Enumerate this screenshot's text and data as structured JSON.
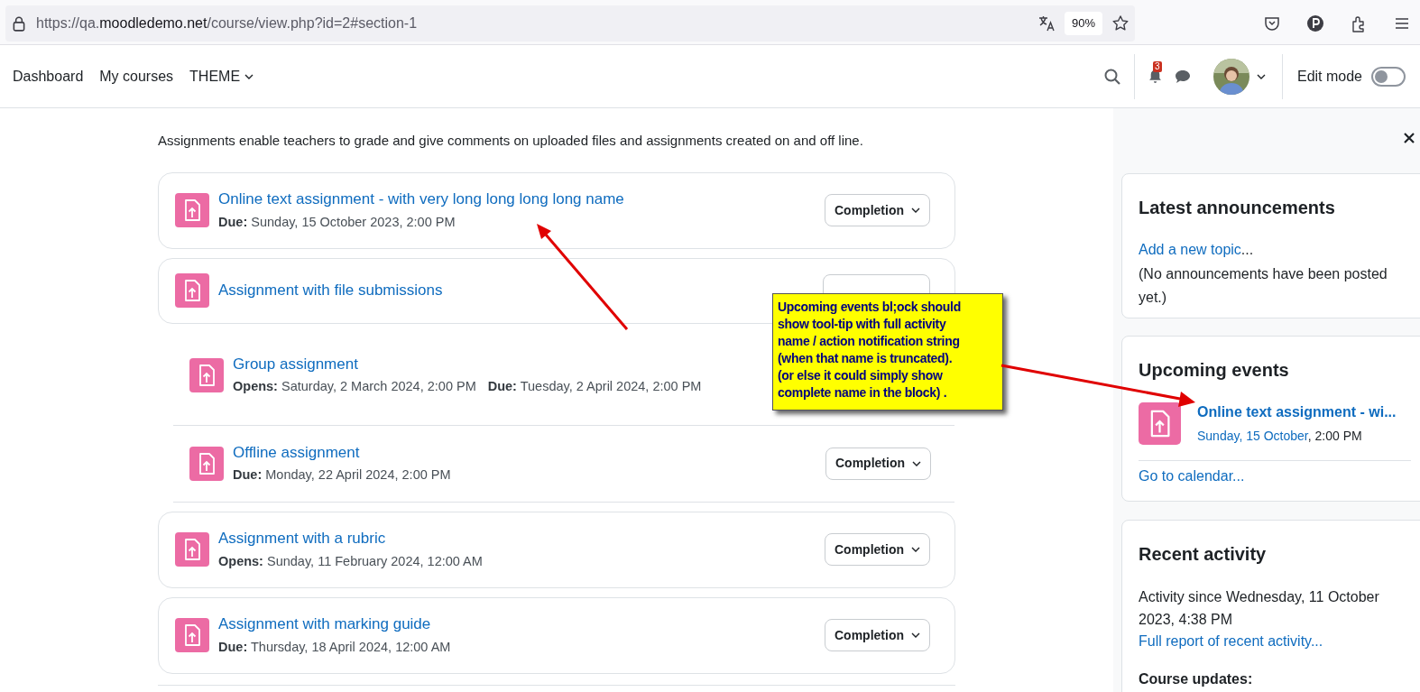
{
  "browser": {
    "url_prefix": "https://qa.",
    "url_domain": "moodledemo.net",
    "url_path": "/course/view.php?id=2#section-1",
    "zoom": "90%"
  },
  "nav": {
    "items": [
      {
        "label": "Dashboard",
        "dropdown": false
      },
      {
        "label": "My courses",
        "dropdown": false
      },
      {
        "label": "THEME",
        "dropdown": true
      }
    ],
    "notification_count": "3",
    "edit_mode": {
      "label": "Edit mode",
      "on": false
    }
  },
  "section": {
    "description": "Assignments enable teachers to grade and give comments on uploaded files and assignments created on and off line.",
    "activities": [
      {
        "kind": "card",
        "title": "Online text assignment - with very long long long long name",
        "dates": [
          {
            "label": "Due:",
            "value": "Sunday, 15 October 2023, 2:00 PM"
          }
        ],
        "completion": "Completion"
      },
      {
        "kind": "card",
        "title": "Assignment with file submissions",
        "completion_covered": true
      },
      {
        "kind": "row",
        "title": "Group assignment",
        "dates": [
          {
            "label": "Opens:",
            "value": "Saturday, 2 March 2024, 2:00 PM"
          },
          {
            "label": "Due:",
            "value": "Tuesday, 2 April 2024, 2:00 PM"
          }
        ]
      },
      {
        "kind": "row",
        "title": "Offline assignment",
        "dates": [
          {
            "label": "Due:",
            "value": "Monday, 22 April 2024, 2:00 PM"
          }
        ],
        "completion": "Completion"
      },
      {
        "kind": "card",
        "title": "Assignment with a rubric",
        "dates": [
          {
            "label": "Opens:",
            "value": "Sunday, 11 February 2024, 12:00 AM"
          }
        ],
        "completion": "Completion"
      },
      {
        "kind": "card",
        "title": "Assignment with marking guide",
        "dates": [
          {
            "label": "Due:",
            "value": "Thursday, 18 April 2024, 12:00 AM"
          }
        ],
        "completion": "Completion"
      }
    ]
  },
  "drawer": {
    "announcements": {
      "title": "Latest announcements",
      "link": "Add a new topic",
      "link_suffix": "...",
      "note": "(No announcements have been posted yet.)"
    },
    "upcoming": {
      "title": "Upcoming events",
      "event_title": "Online text assignment - wi...",
      "event_date": "Sunday, 15 October",
      "event_time": ", 2:00 PM",
      "calendar_link": "Go to calendar..."
    },
    "recent": {
      "title": "Recent activity",
      "since": "Activity since Wednesday, 11 October 2023, 4:38 PM",
      "report_link": "Full report of recent activity...",
      "updates_heading": "Course updates:"
    }
  },
  "annotation": {
    "lines": [
      "Upcoming events bl;ock should",
      "show tool-tip with full activity",
      "name / action notification string",
      "(when that name is truncated).",
      "(or else it could simply show",
      "complete name in the block) ."
    ]
  }
}
